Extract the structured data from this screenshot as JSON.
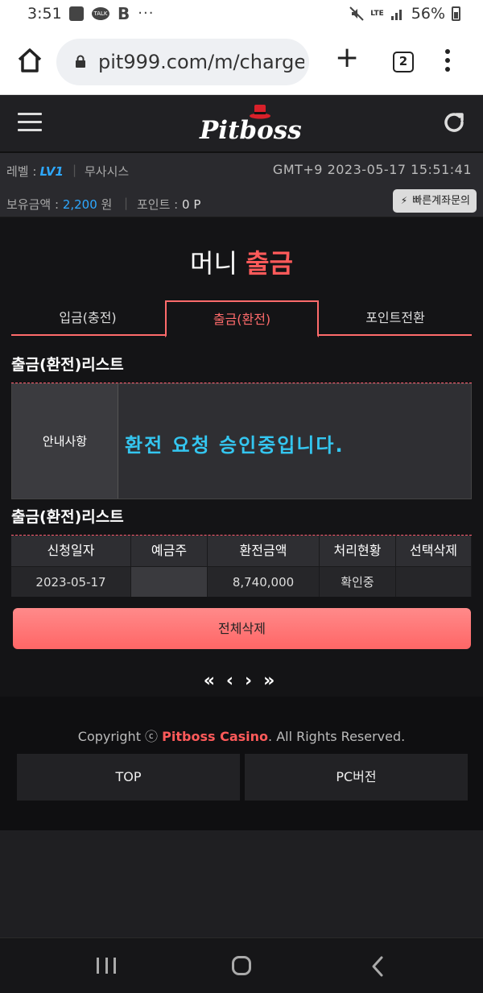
{
  "status_bar": {
    "time": "3:51",
    "talk": "TALK",
    "b": "B",
    "more": "···",
    "lte": "LTE",
    "battery": "56%"
  },
  "browser": {
    "url": "pit999.com/m/charge",
    "tab_count": "2"
  },
  "header": {
    "logo": "Pitboss"
  },
  "user_info": {
    "level_label": "레벨 :",
    "level_value": "LV1",
    "separator": "|",
    "nickname": "무사시스",
    "clock": "GMT+9 2023-05-17 15:51:41",
    "balance_label": "보유금액 :",
    "balance_value": "2,200",
    "balance_unit": "원",
    "point_label": "포인트 :",
    "point_value": "0 P",
    "quick_inquiry_label": "빠른계좌문의"
  },
  "page": {
    "title_prefix": "머니",
    "title_accent": "출금",
    "tabs": [
      {
        "label": "입금(충전)",
        "active": false
      },
      {
        "label": "출금(환전)",
        "active": true
      },
      {
        "label": "포인트전환",
        "active": false
      }
    ],
    "section1_title": "출금(환전)리스트",
    "notice_label": "안내사항",
    "notice_text": "환전 요청 승인중입니다.",
    "section2_title": "출금(환전)리스트",
    "table": {
      "headers": [
        "신청일자",
        "예금주",
        "환전금액",
        "처리현황",
        "선택삭제"
      ],
      "rows": [
        {
          "date": "2023-05-17",
          "holder": "",
          "amount": "8,740,000",
          "status": "확인중",
          "select": ""
        }
      ]
    },
    "delete_all_label": "전체삭제",
    "pager": {
      "first": "«",
      "prev": "‹",
      "next": "›",
      "last": "»"
    }
  },
  "footer": {
    "copyright_prefix": "Copyright ⓒ",
    "brand": "Pitboss Casino",
    "copyright_suffix": ". All Rights Reserved.",
    "top_label": "TOP",
    "pc_label": "PC버전"
  },
  "colors": {
    "accent_red": "#ff5a5a",
    "accent_blue": "#2ea8ff",
    "notice_cyan": "#34c6f0"
  }
}
